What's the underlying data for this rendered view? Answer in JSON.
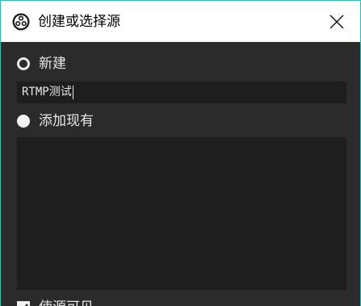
{
  "dialog": {
    "title": "创建或选择源",
    "app_icon": "obs-logo-icon",
    "close_icon": "close-icon"
  },
  "options": {
    "create_new_label": "新建",
    "add_existing_label": "添加现有",
    "selected": "add_existing"
  },
  "name_input": {
    "value": "RTMP测试"
  },
  "existing_sources": [],
  "visible_checkbox": {
    "label": "使源可见",
    "checked": true
  },
  "colors": {
    "accent_border": "#2bbfae",
    "background": "#2b2b2b",
    "field_background": "#1e1e1e",
    "text": "#e6e6e6"
  }
}
